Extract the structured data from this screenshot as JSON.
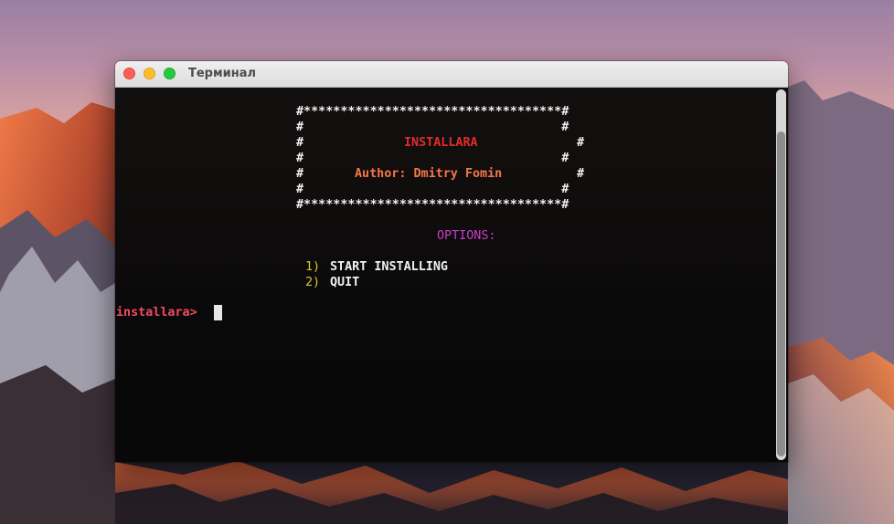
{
  "window": {
    "title": "Терминал"
  },
  "terminal": {
    "banner": {
      "border_top": "#***********************************#",
      "empty_line_1": "#                                   #",
      "title_left": "#",
      "title_text": "INSTALLARA",
      "title_right": "#",
      "empty_line_2": "#                                   #",
      "author_left": "#",
      "author_text": "Author: Dmitry Fomin",
      "author_right": "#",
      "empty_line_3": "#                                   #",
      "border_bottom": "#***********************************#"
    },
    "options_header": "OPTIONS:",
    "options": [
      {
        "number": "1)",
        "label": "START INSTALLING"
      },
      {
        "number": "2)",
        "label": "QUIT"
      }
    ],
    "prompt": "installara>"
  },
  "colors": {
    "title": "#e32b2b",
    "author": "#f27749",
    "options_header": "#c440c4",
    "option_number": "#d9c826",
    "prompt": "#ef4d5d"
  }
}
